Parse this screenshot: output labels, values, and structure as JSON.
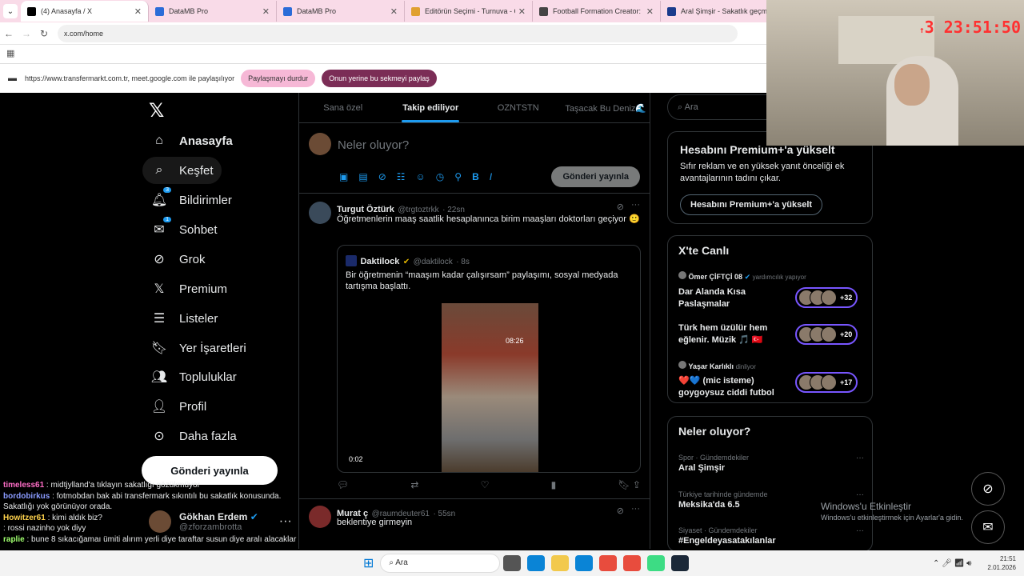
{
  "browser": {
    "tabs": [
      "(4) Anasayfa / X",
      "DataMB Pro",
      "DataMB Pro",
      "Editörün Seçimi - Turnuva - Qu",
      "Football Formation Creator: Re",
      "Aral Şimşir - Sakatlık geçmi"
    ],
    "url": "x.com/home"
  },
  "share": {
    "text": "https://www.transfermarkt.com.tr, meet.google.com ile paylaşılıyor",
    "stop": "Paylaşmayı durdur",
    "switch": "Onun yerine bu sekmeyi paylaş"
  },
  "nav": {
    "items": [
      "Anasayfa",
      "Keşfet",
      "Bildirimler",
      "Sohbet",
      "Grok",
      "Premium",
      "Listeler",
      "Yer İşaretleri",
      "Topluluklar",
      "Profil",
      "Daha fazla"
    ],
    "badge_notif": "3",
    "badge_chat": "1",
    "post": "Gönderi yayınla"
  },
  "profile": {
    "name": "Gökhan Erdem",
    "handle": "@zforzambrotta"
  },
  "feed": {
    "tabs": [
      "Sana özel",
      "Takip ediliyor",
      "OZNTSTN",
      "Taşacak Bu Deniz🌊"
    ],
    "compose_placeholder": "Neler oluyor?",
    "compose_btn": "Gönderi yayınla",
    "t1": {
      "name": "Turgut Öztürk",
      "handle": "@trgtoztrkk",
      "time": "· 22sn",
      "text": "Öğretmenlerin maaş saatlik hesaplanınca birim maaşları doktorları geçiyor 🙂"
    },
    "q1": {
      "name": "Daktilock",
      "handle": "@daktilock",
      "time": "· 8s",
      "text": "Bir öğretmenin “maaşım kadar çalışırsam” paylaşımı, sosyal medyada tartışma başlattı.",
      "video_time": "0:02",
      "overlay": "08:26"
    },
    "t2": {
      "name": "Murat ç",
      "handle": "@raumdeuter61",
      "time": "· 55sn",
      "text": "beklentiye girmeyin"
    }
  },
  "right": {
    "search": "Ara",
    "premium_title": "Hesabını Premium+'a yükselt",
    "premium_text": "Sıfır reklam ve en yüksek yanıt önceliği ek avantajlarının tadını çıkar.",
    "premium_btn": "Hesabını Premium+'a yükselt",
    "live_title": "X'te Canlı",
    "live": [
      {
        "host": "Ömer ÇİFTÇİ 08",
        "status": "yardımcılık yapıyor",
        "title": "Dar Alanda Kısa Paslaşmalar",
        "count": "+32"
      },
      {
        "host": "",
        "status": "",
        "title": "Türk hem üzülür hem eğlenir. Müzik 🎵 🇹🇷",
        "count": "+20"
      },
      {
        "host": "Yaşar Karlıklı",
        "status": "dinliyor",
        "title": "❤️💙 (mic isteme) goygoysuz ciddi futbol",
        "count": "+17"
      }
    ],
    "trends_title": "Neler oluyor?",
    "trends": [
      {
        "cat": "Spor · Gündemdekiler",
        "title": "Aral Şimşir"
      },
      {
        "cat": "Türkiye tarihinde gündemde",
        "title": "Meksika'da 6.5"
      },
      {
        "cat": "Siyaset · Gündemdekiler",
        "title": "#Engeldeyasatakılanlar"
      }
    ]
  },
  "windows": {
    "activate": "Windows'u Etkinleştir",
    "activate_sub": "Windows'u etkinleştirmek için Ayarlar'a gidin.",
    "search": "Ara",
    "clock": "21:51",
    "date": "2.01.2026"
  },
  "stream": {
    "timer": "23:51:50",
    "days": "3"
  },
  "chat": [
    {
      "user": "timeless61",
      "msg": "midtjylland'a tıklayın sakatlığı gözükmüyor",
      "color": "#ff6ec7"
    },
    {
      "user": "bordobirkus",
      "msg": "fotmobdan bak abi transfermark sıkıntılı bu sakatlık konusunda. Sakatlığı yok görünüyor orada.",
      "color": "#8a9bff"
    },
    {
      "user": "Howitzer61",
      "msg": "kimi aldık biz?",
      "color": "#ffd34d"
    },
    {
      "user": "",
      "msg": "rossi nazinho yok diyy",
      "color": "#6fb3ff"
    },
    {
      "user": "raplie",
      "msg": "bune 8 sıkacığamaı ümiti alırım yerli diye taraftar susun diye aralı alacaklar",
      "color": "#a0ff6e"
    }
  ]
}
